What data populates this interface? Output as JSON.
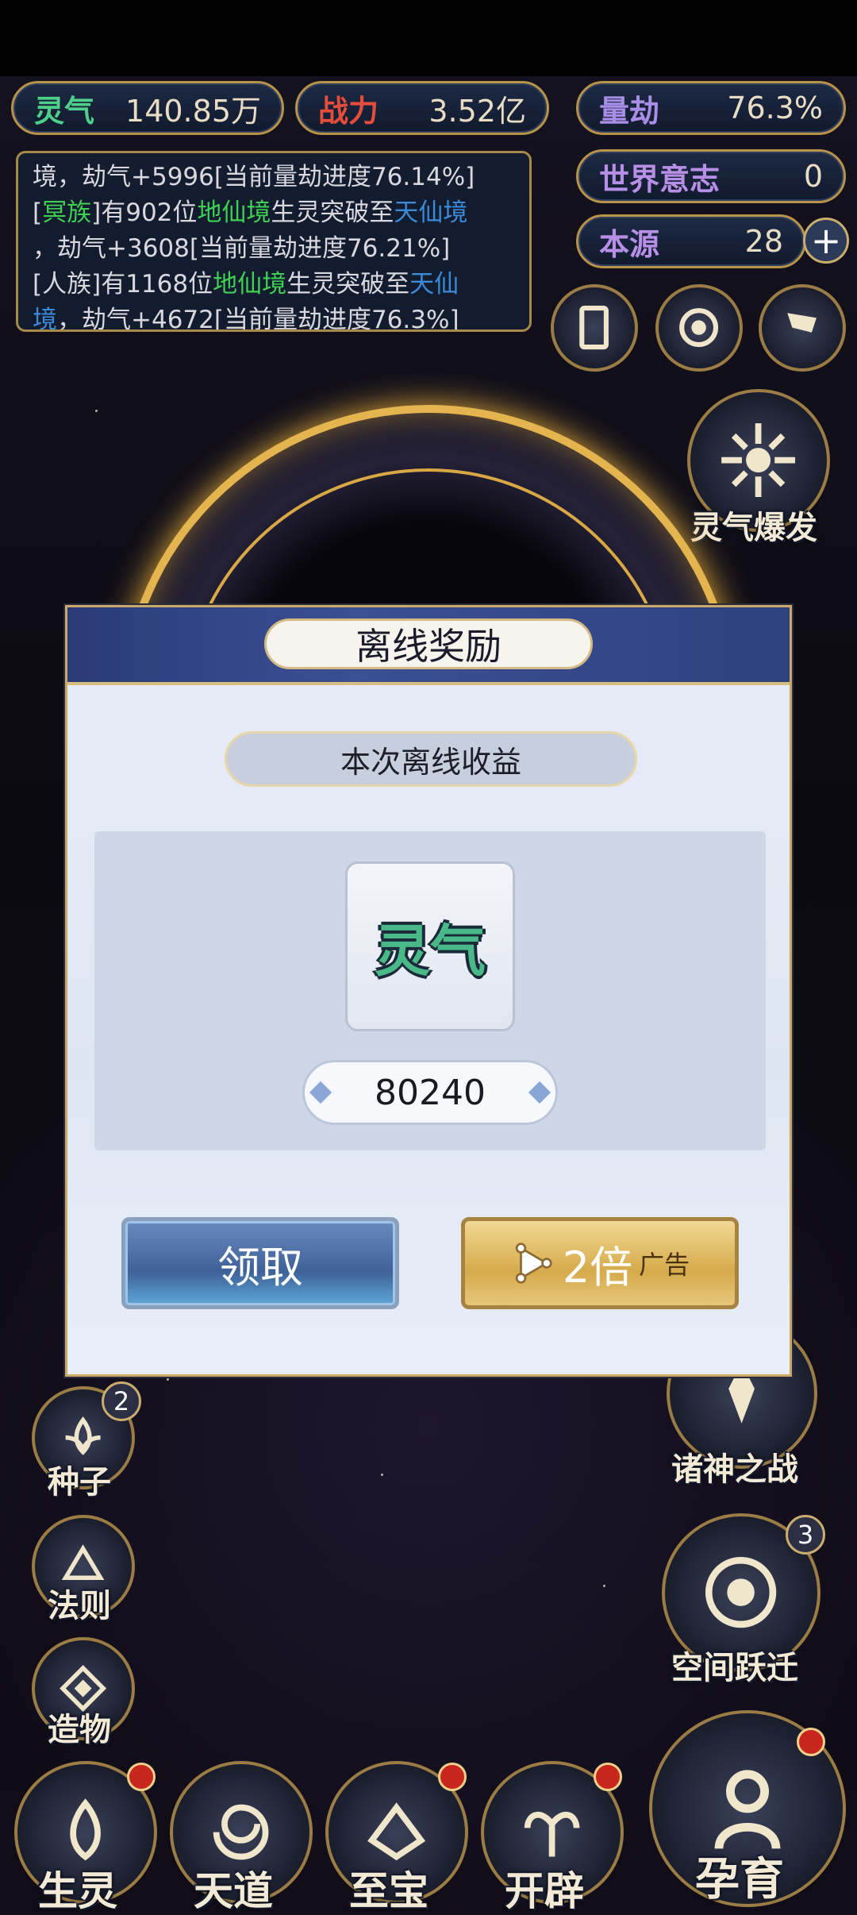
{
  "resources": {
    "lingqi": {
      "label": "灵气",
      "value": "140.85万"
    },
    "zhanli": {
      "label": "战力",
      "value": "3.52亿"
    },
    "liangjie": {
      "label": "量劫",
      "value": "76.3%"
    },
    "world_will": {
      "label": "世界意志",
      "value": "0"
    },
    "origin": {
      "label": "本源",
      "value": "28"
    }
  },
  "log": {
    "line1": "境，劫气+5996[当前量劫进度76.14%]",
    "e2_race": "冥族",
    "e2_a": "有902位",
    "e2_realm": "地仙境",
    "e2_b": "生灵突破至",
    "e2_target": "天仙境",
    "e2_c": "，劫气+3608[当前量劫进度76.21%]",
    "e3_race": "[人族]",
    "e3_a": "有1168位",
    "e3_realm": "地仙境",
    "e3_b": "生灵突破至",
    "e3_target": "天仙",
    "e3_target2": "境",
    "e3_c": "，劫气+4672[当前量劫进度76.3%]"
  },
  "right_menu": {
    "burst": "灵气爆发",
    "gods_war": "诸神之战",
    "space_jump": "空间跃迁",
    "space_jump_badge": "3"
  },
  "left_menu": {
    "seeds": "种子",
    "seeds_badge": "2",
    "laws": "法则",
    "creation": "造物"
  },
  "bottom_nav": [
    "生灵",
    "天道",
    "至宝",
    "开辟",
    "孕育"
  ],
  "modal": {
    "title": "离线奖励",
    "subtitle": "本次离线收益",
    "item_name": "灵气",
    "amount": "80240",
    "claim_label": "领取",
    "double_label": "2倍",
    "ad_label": "广告"
  },
  "colors": {
    "gold": "#c9a96a",
    "green_text": "#3fcf52",
    "blue_text": "#3a8ad8",
    "lingqi_color": "#4fd08a",
    "zhanli_color": "#e34d3a",
    "liangjie_color": "#a98ee8"
  }
}
